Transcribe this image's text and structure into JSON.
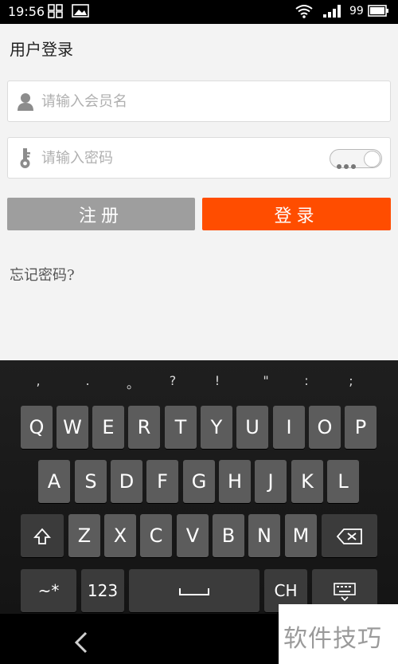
{
  "status_bar": {
    "time": "19:56",
    "battery": "99"
  },
  "header": {
    "title": "用户登录"
  },
  "form": {
    "username_placeholder": "请输入会员名",
    "password_placeholder": "请输入密码",
    "register_label": "注册",
    "login_label": "登录",
    "forgot_password": "忘记密码?"
  },
  "keyboard": {
    "suggestions": [
      ",",
      ".",
      "。",
      "?",
      "!",
      "\"",
      ":",
      ";"
    ],
    "row1": [
      "Q",
      "W",
      "E",
      "R",
      "T",
      "Y",
      "U",
      "I",
      "O",
      "P"
    ],
    "row2": [
      "A",
      "S",
      "D",
      "F",
      "G",
      "H",
      "J",
      "K",
      "L"
    ],
    "row3": [
      "Z",
      "X",
      "C",
      "V",
      "B",
      "N",
      "M"
    ],
    "symbols_key": "~*",
    "numbers_key": "123",
    "language_key": "CH"
  },
  "watermark": "软件技巧",
  "colors": {
    "accent": "#ff4d00",
    "secondary_button": "#9e9e9e"
  }
}
